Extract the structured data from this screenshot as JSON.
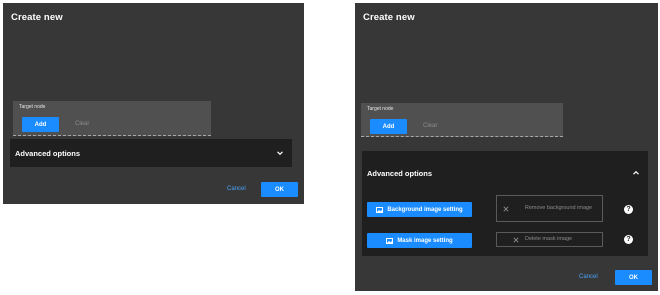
{
  "dialog": {
    "title": "Create new",
    "target_node": {
      "label": "Target node",
      "add_label": "Add",
      "clear_label": "Clear"
    },
    "advanced": {
      "title": "Advanced options",
      "background_btn": "Background image setting",
      "remove_background_btn": "Remove background image",
      "mask_btn": "Mask image setting",
      "delete_mask_btn": "Delete mask image",
      "help_glyph": "?"
    },
    "footer": {
      "cancel_label": "Cancel",
      "ok_label": "OK"
    }
  },
  "colors": {
    "dialog_bg": "#373737",
    "panel_bg": "#1f1f1f",
    "accent": "#1a8cff"
  },
  "icons": [
    "chevron-down-icon",
    "chevron-up-icon",
    "image-icon",
    "close-icon",
    "help-icon"
  ]
}
